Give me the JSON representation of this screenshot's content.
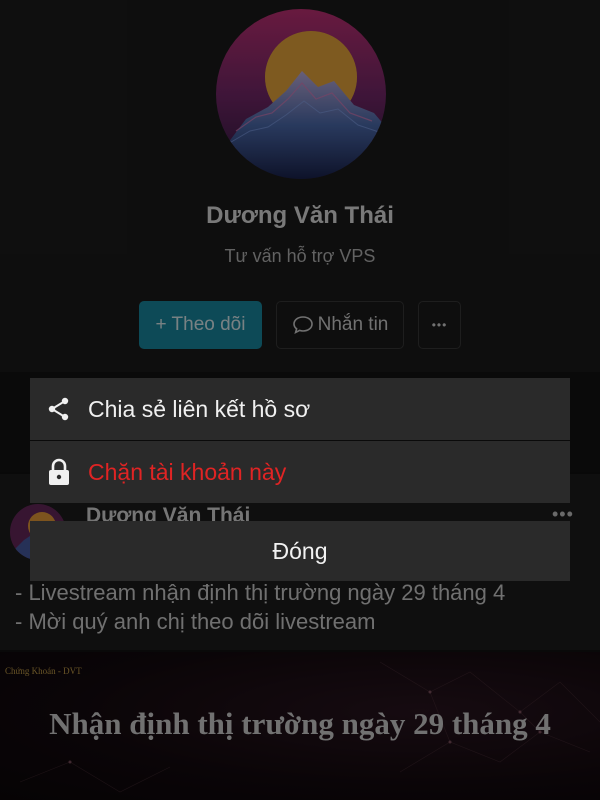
{
  "profile": {
    "name": "Dương Văn Thái",
    "bio": "Tư vấn hỗ trợ VPS",
    "follow_label": "+ Theo dõi",
    "message_label": "Nhắn tin",
    "more_label": "•••"
  },
  "post": {
    "author": "Dương Văn Thái",
    "options_label": "•••",
    "lines": [
      "- Livestream nhận định thị trường ngày 29 tháng 4",
      "- Mời quý anh chị theo dõi livestream"
    ],
    "thumbnail": {
      "brand": "Chứng Khoán - DVT",
      "title": "Nhận định thị trường ngày 29 tháng 4"
    }
  },
  "action_sheet": {
    "share_label": "Chia sẻ liên kết hồ sơ",
    "block_label": "Chặn tài khoản này",
    "close_label": "Đóng"
  },
  "colors": {
    "accent": "#1a8fa8",
    "danger": "#e02424",
    "sheet_bg": "#2a2a2a"
  },
  "icons": {
    "share": "share-icon",
    "lock": "lock-icon",
    "message": "chat-bubble-icon",
    "more": "more-horizontal-icon"
  }
}
